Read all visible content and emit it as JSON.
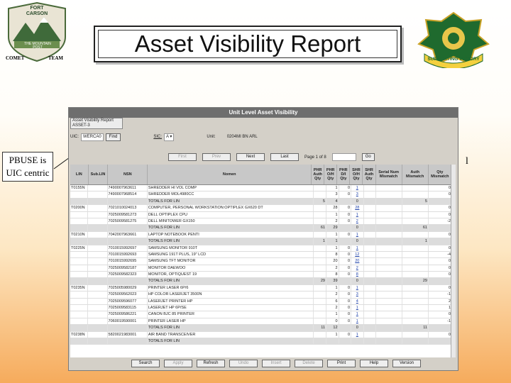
{
  "slide": {
    "title": "Asset Visibility Report",
    "callout": "PBUSE is UIC centric",
    "stray_mark": "l",
    "left_logo": {
      "top_text": "FORT CARSON",
      "mid_text": "THE MOUNTAIN POST",
      "bottom_left": "COMET",
      "bottom_right": "TEAM"
    },
    "right_logo": {
      "banner": "SUPPORTING VICTORY"
    }
  },
  "app": {
    "window_title": "Unit Level Asset Visibility",
    "tab_label": "Asset Visibility Report",
    "tab_sub": "ASSET-3",
    "uic_label": "UIC:",
    "uic_value": "WERCA0",
    "find_button": "Find",
    "sic_label": "SIC:",
    "sic_value": "A",
    "unit_label": "Unit:",
    "unit_value": "0204MI BN ARL",
    "pager": {
      "first": "First",
      "prev": "Prev",
      "next": "Next",
      "last": "Last",
      "page_text": "Page 1 of 8",
      "go": "Go"
    },
    "columns": [
      "LIN",
      "Sub.LIN",
      "NSN",
      "Nomen",
      "PHR Auth Qty",
      "PHR O/H Qty",
      "PHR D/I Qty",
      "SHR O/H Qty",
      "SHR Auth Qty",
      "Serial Num Mismatch",
      "Auth Mismatch",
      "Qty Mismatch"
    ],
    "rows": [
      {
        "lin": "T0155N",
        "sub": "",
        "nsn": "7490007963611",
        "nomen": "SHREDDER HI VOL COMP",
        "pa": "",
        "po": "1",
        "pd": "0",
        "so": "1",
        "sa": "",
        "sn": "",
        "am": "",
        "qm": "0",
        "link": true
      },
      {
        "lin": "",
        "sub": "",
        "nsn": "7490007968514",
        "nomen": "SHREDDER MOL4980CC",
        "pa": "",
        "po": "3",
        "pd": "0",
        "so": "3",
        "sa": "",
        "sn": "",
        "am": "",
        "qm": "0",
        "link": true
      },
      {
        "lin": "",
        "sub": "",
        "nsn": "",
        "nomen": "TOTALS FOR LIN",
        "pa": "5",
        "po": "4",
        "pd": "",
        "so": "0",
        "sa": "",
        "sn": "",
        "am": "5",
        "qm": "",
        "tot": true
      },
      {
        "lin": "T0200N",
        "sub": "",
        "nsn": "7021010024013",
        "nomen": "COMPUTER, PERSONAL WORKSTATION:OPTIPLEX GX620 DT",
        "pa": "",
        "po": "28",
        "pd": "0",
        "so": "28",
        "sa": "",
        "sn": "",
        "am": "",
        "qm": "0",
        "link": true
      },
      {
        "lin": "",
        "sub": "",
        "nsn": "7025009581273",
        "nomen": "DELL OPTIPLEX CPU",
        "pa": "",
        "po": "1",
        "pd": "0",
        "so": "1",
        "sa": "",
        "sn": "",
        "am": "",
        "qm": "0",
        "link": true
      },
      {
        "lin": "",
        "sub": "",
        "nsn": "7025009581275",
        "nomen": "DELL MINITOWER GX150",
        "pa": "",
        "po": "2",
        "pd": "0",
        "so": "2",
        "sa": "",
        "sn": "",
        "am": "",
        "qm": "-2",
        "link": true
      },
      {
        "lin": "",
        "sub": "",
        "nsn": "",
        "nomen": "TOTALS FOR LIN",
        "pa": "61",
        "po": "29",
        "pd": "",
        "so": "0",
        "sa": "",
        "sn": "",
        "am": "61",
        "qm": "",
        "tot": true
      },
      {
        "lin": "T0210N",
        "sub": "",
        "nsn": "7042007963661",
        "nomen": "LAPTOP NOTEBOOK PENTI",
        "pa": "",
        "po": "1",
        "pd": "0",
        "so": "1",
        "sa": "",
        "sn": "",
        "am": "",
        "qm": "0",
        "link": true
      },
      {
        "lin": "",
        "sub": "",
        "nsn": "",
        "nomen": "TOTALS FOR LIN",
        "pa": "1",
        "po": "1",
        "pd": "",
        "so": "0",
        "sa": "",
        "sn": "",
        "am": "1",
        "qm": "",
        "tot": true
      },
      {
        "lin": "T0225N",
        "sub": "",
        "nsn": "7010015992697",
        "nomen": "SAMSUNG MONITOR 910T",
        "pa": "",
        "po": "1",
        "pd": "0",
        "so": "1",
        "sa": "",
        "sn": "",
        "am": "",
        "qm": "0",
        "link": true
      },
      {
        "lin": "",
        "sub": "",
        "nsn": "7010015992693",
        "nomen": "SAMSUNG 191T PLUS, 19\" LCD",
        "pa": "",
        "po": "8",
        "pd": "0",
        "so": "12",
        "sa": "",
        "sn": "",
        "am": "",
        "qm": "-4",
        "link": true
      },
      {
        "lin": "",
        "sub": "",
        "nsn": "7010015992695",
        "nomen": "SAMSUNG TFT MONITOR",
        "pa": "",
        "po": "20",
        "pd": "0",
        "so": "20",
        "sa": "",
        "sn": "",
        "am": "",
        "qm": "0",
        "link": true
      },
      {
        "lin": "",
        "sub": "",
        "nsn": "7025009582187",
        "nomen": "MONITOR DAEWOO",
        "pa": "",
        "po": "2",
        "pd": "0",
        "so": "2",
        "sa": "",
        "sn": "",
        "am": "",
        "qm": "0",
        "link": true
      },
      {
        "lin": "",
        "sub": "",
        "nsn": "7025009582323",
        "nomen": "MONITOR, OPTIQUEST 19",
        "pa": "",
        "po": "8",
        "pd": "0",
        "so": "8",
        "sa": "",
        "sn": "",
        "am": "",
        "qm": "0",
        "link": true
      },
      {
        "lin": "",
        "sub": "",
        "nsn": "",
        "nomen": "TOTALS FOR LIN",
        "pa": "29",
        "po": "39",
        "pd": "",
        "so": "0",
        "sa": "",
        "sn": "",
        "am": "29",
        "qm": "",
        "tot": true
      },
      {
        "lin": "T0235N",
        "sub": "",
        "nsn": "7025005980029",
        "nomen": "PRINTER LASER 6P/6",
        "pa": "",
        "po": "1",
        "pd": "0",
        "so": "1",
        "sa": "",
        "sn": "",
        "am": "",
        "qm": "0",
        "link": true
      },
      {
        "lin": "",
        "sub": "",
        "nsn": "7025009562023",
        "nomen": "HP COLOR LASERJET 3500N",
        "pa": "",
        "po": "2",
        "pd": "0",
        "so": "3",
        "sa": "",
        "sn": "",
        "am": "",
        "qm": "-1",
        "link": true
      },
      {
        "lin": "",
        "sub": "",
        "nsn": "7025009596077",
        "nomen": "LASERJET PRINTER HP",
        "pa": "",
        "po": "6",
        "pd": "0",
        "so": "4",
        "sa": "",
        "sn": "",
        "am": "",
        "qm": "2",
        "link": true
      },
      {
        "lin": "",
        "sub": "",
        "nsn": "7025009583115",
        "nomen": "LASERJET HP 6P/SE",
        "pa": "",
        "po": "2",
        "pd": "0",
        "so": "1",
        "sa": "",
        "sn": "",
        "am": "",
        "qm": "1",
        "link": true
      },
      {
        "lin": "",
        "sub": "",
        "nsn": "7025009586221",
        "nomen": "CANON BJC 85 PRINTER",
        "pa": "",
        "po": "1",
        "pd": "0",
        "so": "1",
        "sa": "",
        "sn": "",
        "am": "",
        "qm": "0",
        "link": true
      },
      {
        "lin": "",
        "sub": "",
        "nsn": "7060019590001",
        "nomen": "PRINTER LASER HP",
        "pa": "",
        "po": "0",
        "pd": "0",
        "so": "1",
        "sa": "",
        "sn": "",
        "am": "",
        "qm": "-1",
        "link": true
      },
      {
        "lin": "",
        "sub": "",
        "nsn": "",
        "nomen": "TOTALS FOR LIN",
        "pa": "11",
        "po": "12",
        "pd": "",
        "so": "0",
        "sa": "",
        "sn": "",
        "am": "11",
        "qm": "",
        "tot": true
      },
      {
        "lin": "T0238N",
        "sub": "",
        "nsn": "5820021983001",
        "nomen": "AIR BAND TRANSCEIVER",
        "pa": "",
        "po": "1",
        "pd": "0",
        "so": "1",
        "sa": "",
        "sn": "",
        "am": "",
        "qm": "0",
        "link": true
      },
      {
        "lin": "",
        "sub": "",
        "nsn": "",
        "nomen": "TOTALS FOR LIN",
        "pa": "",
        "po": "",
        "pd": "",
        "so": "",
        "sa": "",
        "sn": "",
        "am": "",
        "qm": "",
        "tot": true
      }
    ],
    "footer_buttons": [
      {
        "label": "Search",
        "enabled": true
      },
      {
        "label": "Apply",
        "enabled": false
      },
      {
        "label": "Refresh",
        "enabled": true
      },
      {
        "label": "Undo",
        "enabled": false
      },
      {
        "label": "Insert",
        "enabled": false
      },
      {
        "label": "Delete",
        "enabled": false
      },
      {
        "label": "Print",
        "enabled": true
      },
      {
        "label": "Help",
        "enabled": true
      },
      {
        "label": "Version",
        "enabled": true
      }
    ]
  }
}
